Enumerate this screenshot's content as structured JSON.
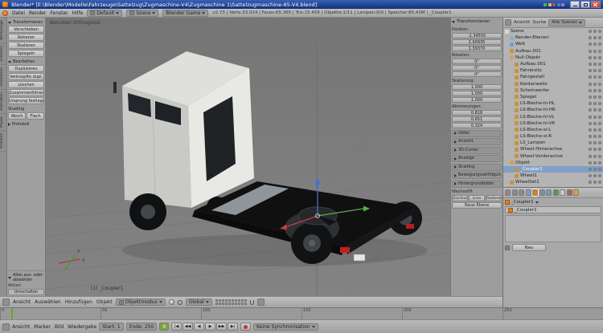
{
  "titlebar": {
    "title": "Blender* [E:\\Blender\\Modelle\\Fahrzeuge\\Sattelzug\\Zugmaschine-V4\\Zugmaschine 1\\Sattelzugmaschine-65-V4.blend]"
  },
  "topheader": {
    "menus": [
      "Datei",
      "Render",
      "Fenster",
      "Hilfe"
    ],
    "layout": "Default",
    "scene": "Szene",
    "engine": "Blender Game",
    "stats": "v2.73 | Verts:33.024 | Faces:65.365 | Tris:15.458 | Objekte:1/11 | Lampen:0/0 | Speicher:65.41M | _Coupler1"
  },
  "toolshelf": {
    "tabs": [
      "Werkzeuge",
      "Erstellen",
      "Relationen",
      "Animation",
      "Physik",
      "Protokoll"
    ],
    "transform": {
      "title": "Transformieren",
      "buttons": [
        "Verschieben",
        "Rotieren",
        "Skalieren"
      ],
      "mirror": "Spiegeln"
    },
    "edit": {
      "title": "Bearbeiten",
      "buttons": [
        "Duplizieren",
        "Verknüpfte dupl.",
        "Löschen",
        "Zusammenführen",
        "Ursprung festlegen"
      ]
    },
    "shading": {
      "title": "Shading",
      "smooth": "Weich",
      "flat": "Flach"
    },
    "history": {
      "title": "Protokoll"
    },
    "redo": {
      "title": "Alles aus- oder abwählen",
      "field_label": "Aktion",
      "value": "Umschalten"
    }
  },
  "viewport": {
    "view_label": "Benutzer Orthogonal",
    "object_label": "(1) _Coupler1",
    "axis": {
      "x": "x",
      "y": "y"
    }
  },
  "view3d_header": {
    "menus": [
      "Ansicht",
      "Auswählen",
      "Hinzufügen",
      "Objekt"
    ],
    "mode": "Objektmodus",
    "orientation": "Global",
    "layers": [
      1,
      0,
      0,
      0,
      0,
      0,
      0,
      0,
      0,
      0,
      0,
      0,
      0,
      0,
      0,
      0,
      0,
      0,
      0,
      0
    ]
  },
  "npanel": {
    "title": "Transformieren",
    "groups": [
      {
        "label": "Position:",
        "fields": [
          "-1.34550",
          "2.90935",
          "1.39370"
        ]
      },
      {
        "label": "Rotation:",
        "fields": [
          "0°",
          "0°",
          "0°"
        ]
      },
      {
        "label": "Skalierung:",
        "fields": [
          "1.000",
          "1.000",
          "1.000"
        ]
      },
      {
        "label": "Abmessungen:",
        "fields": [
          "0.818",
          "0.651",
          "0.324"
        ]
      }
    ],
    "sections": [
      "Gitter",
      "Ansicht",
      "3D-Cursor",
      "Anzeige",
      "Shading",
      "Bewegungsverfolgung",
      "Hintergrundbilder"
    ],
    "gpencil": {
      "title": "Wachsstift",
      "buttons": [
        "Zeichnen",
        "Linie",
        "Radieren"
      ],
      "new_layer": "Neue Ebene"
    }
  },
  "outliner": {
    "menu": "Ansicht",
    "search": "Suche",
    "display": "Alle Szenen",
    "rows": [
      {
        "label": "Szene",
        "indent": 2,
        "icon_color": "#d8d8d8"
      },
      {
        "label": "Render-Ebenen",
        "indent": 8,
        "icon_color": "#9aa8b8"
      },
      {
        "label": "Welt",
        "indent": 8,
        "icon_color": "#6fa0d0"
      },
      {
        "label": "Aufbau.001",
        "indent": 8,
        "icon_color": "#c8913f"
      },
      {
        "label": "Null-Objekt",
        "indent": 8,
        "icon_color": "#d0a350"
      },
      {
        "label": "Aufbau.001",
        "indent": 14,
        "icon_color": "#c8913f"
      },
      {
        "label": "Fahrersitz",
        "indent": 14,
        "icon_color": "#c8913f"
      },
      {
        "label": "Fahrgestell",
        "indent": 14,
        "icon_color": "#c8913f"
      },
      {
        "label": "Kardanwelle",
        "indent": 14,
        "icon_color": "#c8913f"
      },
      {
        "label": "Scheinwerfer",
        "indent": 14,
        "icon_color": "#c8913f"
      },
      {
        "label": "Spiegel",
        "indent": 14,
        "icon_color": "#c8913f"
      },
      {
        "label": "LS-Bleche-hi-HL",
        "indent": 14,
        "icon_color": "#c8913f"
      },
      {
        "label": "LS-Bleche-hi-HR",
        "indent": 14,
        "icon_color": "#c8913f"
      },
      {
        "label": "LS-Bleche-hi-VL",
        "indent": 14,
        "icon_color": "#c8913f"
      },
      {
        "label": "LS-Bleche-hi-VR",
        "indent": 14,
        "icon_color": "#c8913f"
      },
      {
        "label": "LS-Bleche-si-L",
        "indent": 14,
        "icon_color": "#c8913f"
      },
      {
        "label": "LS-Bleche-si-R",
        "indent": 14,
        "icon_color": "#c8913f"
      },
      {
        "label": "LS_Lampen",
        "indent": 14,
        "icon_color": "#c8913f"
      },
      {
        "label": "Wheel-Hinterachse",
        "indent": 14,
        "icon_color": "#c8913f"
      },
      {
        "label": "Wheel-Vorderachse",
        "indent": 14,
        "icon_color": "#c8913f"
      },
      {
        "label": "Objekt",
        "indent": 8,
        "icon_color": "#d0a350"
      },
      {
        "label": "_Coupler1",
        "indent": 14,
        "icon_color": "#c8913f",
        "selected": true
      },
      {
        "label": "Wheel1",
        "indent": 14,
        "icon_color": "#c8913f"
      },
      {
        "label": "WheelSet1",
        "indent": 8,
        "icon_color": "#c8913f"
      }
    ]
  },
  "properties": {
    "tabs": [
      {
        "name": "render",
        "color": "#8a8a8a"
      },
      {
        "name": "render-layers",
        "color": "#8a8a8a"
      },
      {
        "name": "scene",
        "color": "#8a8a8a"
      },
      {
        "name": "world",
        "color": "#6f9fd8"
      },
      {
        "name": "object",
        "color": "#e87d0d",
        "active": true
      },
      {
        "name": "constraints",
        "color": "#8a8a8a"
      },
      {
        "name": "modifiers",
        "color": "#7a9ab0"
      },
      {
        "name": "data",
        "color": "#4f9b4f"
      },
      {
        "name": "material",
        "color": "#c8c8c8"
      },
      {
        "name": "texture",
        "color": "#b06060"
      },
      {
        "name": "physics",
        "color": "#d8a040"
      }
    ],
    "breadcrumb": "_Coupler1",
    "name_value": "_Coupler1",
    "new_button": "Neu"
  },
  "timeline": {
    "ticks": [
      "0",
      "50",
      "100",
      "150",
      "200",
      "250"
    ],
    "menus": [
      "Ansicht",
      "Marker",
      "Bild",
      "Wiedergabe"
    ],
    "start_label": "Start:",
    "start_value": "1",
    "end_label": "Ende:",
    "end_value": "250",
    "frame_value": "0",
    "playback": [
      "|◀",
      "◀◀",
      "◀",
      "▶",
      "▶▶",
      "▶|"
    ],
    "sync": "Keine Synchronisation"
  },
  "colors": {
    "object_accent": "#e87d0d",
    "selection": "#80a0c8",
    "axis_x": "#c04040",
    "axis_y": "#5aad4a",
    "axis_z": "#4a6cd4",
    "frame_field": "#7da03c"
  }
}
